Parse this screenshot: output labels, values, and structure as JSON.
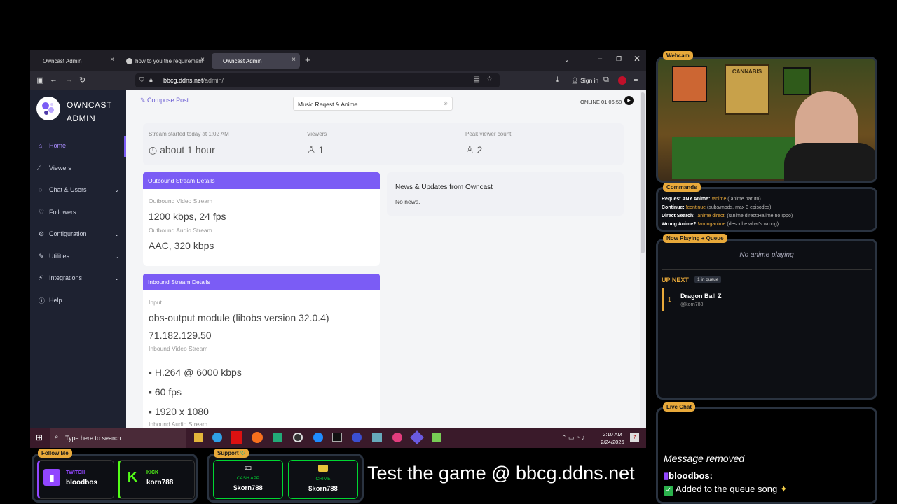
{
  "browser": {
    "tabs": [
      {
        "label": "Owncast Admin"
      },
      {
        "label": "how to you the requirement.txt"
      },
      {
        "label": "Owncast Admin"
      }
    ],
    "url_host": "bbcg.ddns.net",
    "url_path": "/admin/",
    "sign_in": "Sign in"
  },
  "sidebar": {
    "brand_line1": "OWNCAST",
    "brand_line2": "ADMIN",
    "items": [
      {
        "label": "Home",
        "icon": "home-icon"
      },
      {
        "label": "Viewers",
        "icon": "chart-icon"
      },
      {
        "label": "Chat & Users",
        "icon": "chat-icon"
      },
      {
        "label": "Followers",
        "icon": "followers-icon"
      },
      {
        "label": "Configuration",
        "icon": "gear-icon"
      },
      {
        "label": "Utilities",
        "icon": "tool-icon"
      },
      {
        "label": "Integrations",
        "icon": "plug-icon"
      },
      {
        "label": "Help",
        "icon": "help-icon"
      }
    ]
  },
  "main": {
    "compose": "Compose Post",
    "stream_title": "Music Reqest & Anime",
    "online_status": "ONLINE 01:06:58",
    "stats": {
      "started_label": "Stream started today at 1:02 AM",
      "started_value": "about 1 hour",
      "viewers_label": "Viewers",
      "viewers_value": "1",
      "peak_label": "Peak viewer count",
      "peak_value": "2"
    },
    "outbound": {
      "title": "Outbound Stream Details",
      "video_label": "Outbound Video Stream",
      "video_value": "1200 kbps, 24 fps",
      "audio_label": "Outbound Audio Stream",
      "audio_value": "AAC, 320 kbps"
    },
    "inbound": {
      "title": "Inbound Stream Details",
      "input_label": "Input",
      "input_value": "obs-output module (libobs version 32.0.4)",
      "ip": "71.182.129.50",
      "video_label": "Inbound Video Stream",
      "video_items": [
        "H.264 @ 6000 kbps",
        "60 fps",
        "1920 x 1080"
      ],
      "audio_label": "Inbound Audio Stream"
    },
    "news": {
      "title": "News & Updates from Owncast",
      "body": "No news."
    }
  },
  "taskbar": {
    "search_placeholder": "Type here to search",
    "time": "2:10 AM",
    "date": "2/24/2026",
    "notif_count": "7"
  },
  "overlay": {
    "webcam_label": "Webcam",
    "webcam_poster": "CANNABIS",
    "commands_label": "Commands",
    "commands": [
      {
        "name": "Request ANY Anime:",
        "cmd": "!anime",
        "desc": "(!anime naruto)"
      },
      {
        "name": "Continue:",
        "cmd": "!continue",
        "desc": "(subs/mods, max 3 episodes)"
      },
      {
        "name": "Direct Search:",
        "cmd": "!anime direct:",
        "desc": "(!anime direct:Hajime no Ippo)"
      },
      {
        "name": "Wrong Anime?",
        "cmd": "!wronganime",
        "desc": "(describe what's wrong)"
      }
    ],
    "nowplaying_label": "Now Playing + Queue",
    "no_anime": "No anime playing",
    "up_next": "UP NEXT",
    "queue_count": "1 in queue",
    "queue": [
      {
        "num": "1",
        "title": "Dragon Ball Z",
        "by": "@korn788"
      }
    ],
    "livechat_label": "Live Chat",
    "chat_removed": "Message removed",
    "chat_user": "bloodbos:",
    "chat_msg": "Added to the queue song",
    "followme_label": "Follow Me",
    "twitch_label": "TWITCH",
    "twitch_user": "bloodbos",
    "kick_label": "KICK",
    "kick_user": "korn788",
    "support_label": "Support",
    "cashapp_label": "CASH APP",
    "cashapp_user": "$korn788",
    "chime_label": "CHIME",
    "chime_user": "$korn788",
    "banner": "Test the game @ bbcg.ddns.net",
    "accent": "#e8a93a",
    "twitch_color": "#9146ff",
    "kick_color": "#53fc18",
    "cash_color": "#00d632"
  }
}
